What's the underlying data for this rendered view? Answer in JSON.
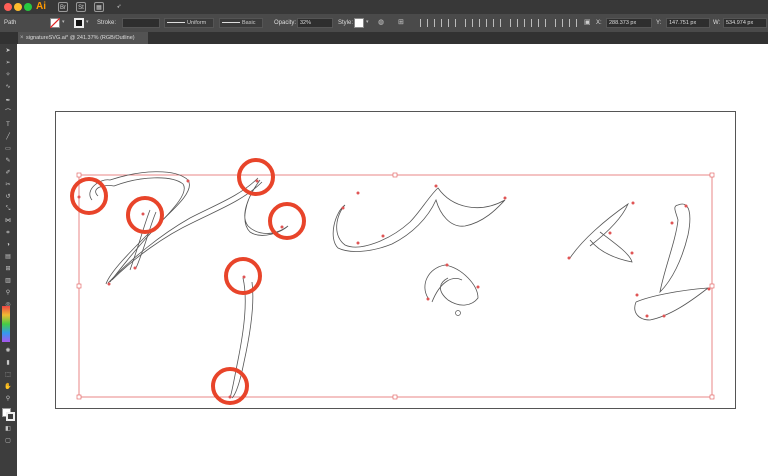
{
  "app": {
    "icon_label": "Ai"
  },
  "control_bar": {
    "object_type": "Path",
    "stroke_label": "Stroke:",
    "stroke_profile": "Uniform",
    "brush": "Basic",
    "opacity_label": "Opacity:",
    "opacity_value": "32%",
    "style_label": "Style:",
    "x_value": "288.373 px",
    "y_value": "147.751 px",
    "w_value": "534.974 px"
  },
  "document_tab": {
    "label": "signatureSVG.ai* @ 241.37% (RGB/Outline)",
    "close_symbol": "×"
  },
  "colors": {
    "highlight_red": "#e8442a",
    "selection_red": "#e05555",
    "path_gray": "#555555"
  }
}
